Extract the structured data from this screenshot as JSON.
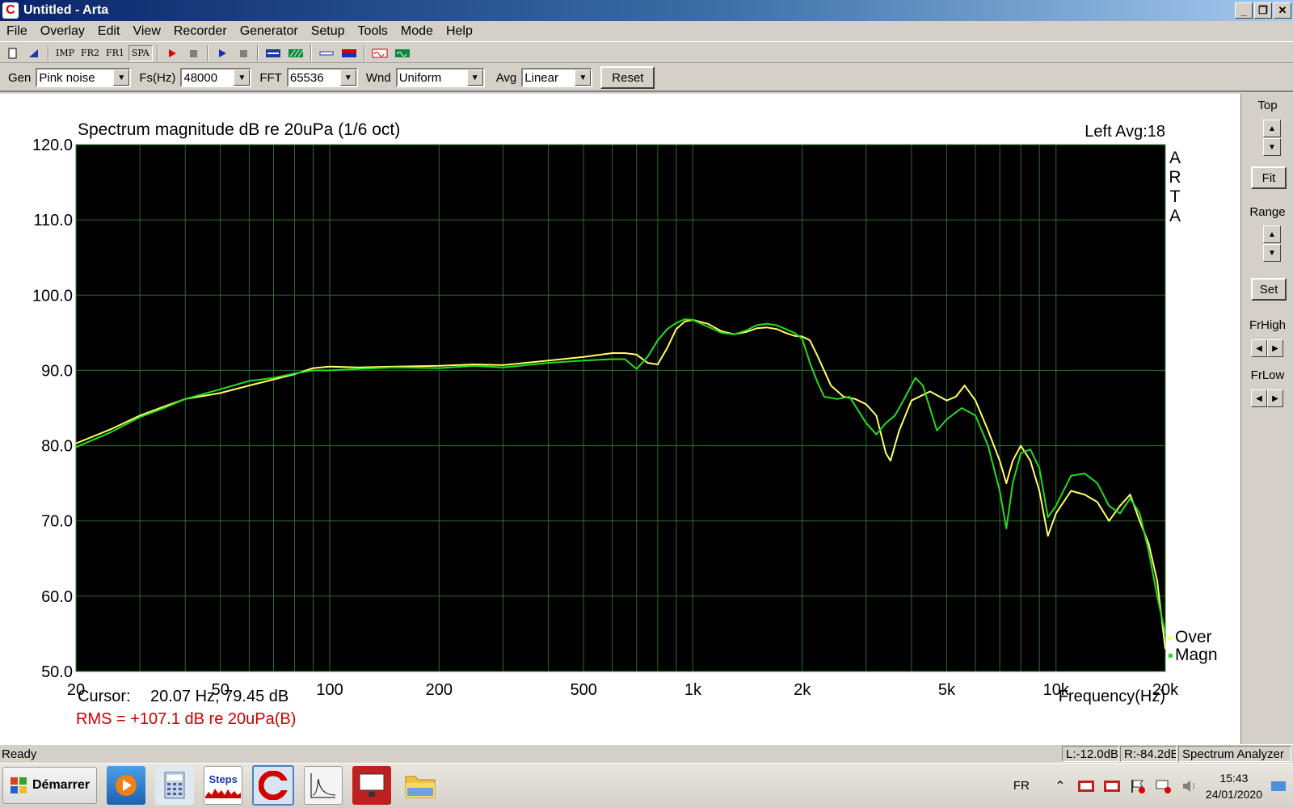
{
  "window": {
    "title": "Untitled - Arta"
  },
  "menu": [
    "File",
    "Overlay",
    "Edit",
    "View",
    "Recorder",
    "Generator",
    "Setup",
    "Tools",
    "Mode",
    "Help"
  ],
  "toolbar": {
    "imp": "IMP",
    "fr2": "FR2",
    "fr1": "FR1",
    "spa": "SPA"
  },
  "controls": {
    "gen_label": "Gen",
    "gen_value": "Pink noise",
    "fs_label": "Fs(Hz)",
    "fs_value": "48000",
    "fft_label": "FFT",
    "fft_value": "65536",
    "wnd_label": "Wnd",
    "wnd_value": "Uniform",
    "avg_label": "Avg",
    "avg_value": "Linear",
    "reset_label": "Reset"
  },
  "right_panel": {
    "top": "Top",
    "fit": "Fit",
    "range": "Range",
    "set": "Set",
    "frhigh": "FrHigh",
    "frlow": "FrLow"
  },
  "plot": {
    "cursor_label": "Cursor:",
    "cursor_value": "20.07 Hz, 79.45 dB",
    "rms": "RMS = +107.1 dB re 20uPa(B)",
    "brand": "ARTA"
  },
  "status": {
    "ready": "Ready",
    "left": "L:-12.0dB",
    "right": "R:-84.2dB",
    "mode": "Spectrum Analyzer"
  },
  "taskbar": {
    "start": "Démarrer",
    "steps": "Steps",
    "lang": "FR",
    "time": "15:43",
    "date": "24/01/2020"
  },
  "colors": {
    "over": "#ffff66",
    "magn": "#22dd22",
    "grid": "#2e6b2e",
    "rms": "#cc0000"
  },
  "chart_data": {
    "type": "line",
    "title": "Spectrum magnitude dB re 20uPa (1/6 oct)",
    "top_right_label": "Left  Avg:18",
    "xlabel": "Frequency(Hz)",
    "ylabel": "",
    "xscale": "log",
    "xlim": [
      20,
      20000
    ],
    "ylim": [
      50,
      120
    ],
    "xticks": [
      {
        "v": 20,
        "label": "20"
      },
      {
        "v": 50,
        "label": "50"
      },
      {
        "v": 100,
        "label": "100"
      },
      {
        "v": 200,
        "label": "200"
      },
      {
        "v": 500,
        "label": "500"
      },
      {
        "v": 1000,
        "label": "1k"
      },
      {
        "v": 2000,
        "label": "2k"
      },
      {
        "v": 5000,
        "label": "5k"
      },
      {
        "v": 10000,
        "label": "10k"
      },
      {
        "v": 20000,
        "label": "20k"
      }
    ],
    "yticks": [
      {
        "v": 120,
        "label": "120.0"
      },
      {
        "v": 110,
        "label": "110.0"
      },
      {
        "v": 100,
        "label": "100.0"
      },
      {
        "v": 90,
        "label": "90.0"
      },
      {
        "v": 80,
        "label": "80.0"
      },
      {
        "v": 70,
        "label": "70.0"
      },
      {
        "v": 60,
        "label": "60.0"
      },
      {
        "v": 50,
        "label": "50.0"
      }
    ],
    "grid": true,
    "legend_position": "bottom-right",
    "series": [
      {
        "name": "Over",
        "color": "#ffff66",
        "points": [
          [
            20,
            80.3
          ],
          [
            25,
            82.2
          ],
          [
            30,
            84
          ],
          [
            35,
            85.2
          ],
          [
            40,
            86.2
          ],
          [
            50,
            87
          ],
          [
            60,
            88
          ],
          [
            70,
            88.8
          ],
          [
            80,
            89.5
          ],
          [
            90,
            90.3
          ],
          [
            100,
            90.5
          ],
          [
            120,
            90.4
          ],
          [
            150,
            90.5
          ],
          [
            200,
            90.6
          ],
          [
            250,
            90.8
          ],
          [
            300,
            90.7
          ],
          [
            400,
            91.3
          ],
          [
            500,
            91.8
          ],
          [
            600,
            92.3
          ],
          [
            650,
            92.3
          ],
          [
            700,
            92.1
          ],
          [
            750,
            91
          ],
          [
            800,
            90.8
          ],
          [
            850,
            93
          ],
          [
            900,
            95.5
          ],
          [
            950,
            96.5
          ],
          [
            1000,
            96.7
          ],
          [
            1100,
            96.2
          ],
          [
            1200,
            95.2
          ],
          [
            1300,
            94.8
          ],
          [
            1400,
            95.1
          ],
          [
            1500,
            95.6
          ],
          [
            1600,
            95.7
          ],
          [
            1700,
            95.5
          ],
          [
            1800,
            95
          ],
          [
            1900,
            94.6
          ],
          [
            2000,
            94.5
          ],
          [
            2100,
            94
          ],
          [
            2200,
            92
          ],
          [
            2400,
            88
          ],
          [
            2600,
            86.5
          ],
          [
            2800,
            86.2
          ],
          [
            3000,
            85.5
          ],
          [
            3200,
            84
          ],
          [
            3400,
            79
          ],
          [
            3500,
            78
          ],
          [
            3700,
            82
          ],
          [
            4000,
            86
          ],
          [
            4500,
            87.2
          ],
          [
            5000,
            86
          ],
          [
            5300,
            86.5
          ],
          [
            5600,
            88
          ],
          [
            6000,
            86
          ],
          [
            6500,
            82
          ],
          [
            7000,
            78
          ],
          [
            7300,
            75
          ],
          [
            7600,
            78
          ],
          [
            8000,
            80
          ],
          [
            8500,
            78
          ],
          [
            9000,
            74
          ],
          [
            9500,
            68
          ],
          [
            10000,
            71
          ],
          [
            11000,
            74
          ],
          [
            12000,
            73.5
          ],
          [
            13000,
            72.5
          ],
          [
            14000,
            70
          ],
          [
            15000,
            72
          ],
          [
            16000,
            73.5
          ],
          [
            17000,
            70
          ],
          [
            18000,
            67
          ],
          [
            19000,
            62
          ],
          [
            20000,
            53
          ]
        ]
      },
      {
        "name": "Magn",
        "color": "#22dd22",
        "points": [
          [
            20,
            79.8
          ],
          [
            25,
            81.8
          ],
          [
            30,
            83.8
          ],
          [
            35,
            85
          ],
          [
            40,
            86.2
          ],
          [
            50,
            87.5
          ],
          [
            60,
            88.6
          ],
          [
            70,
            89
          ],
          [
            80,
            89.6
          ],
          [
            90,
            90
          ],
          [
            100,
            90
          ],
          [
            120,
            90.2
          ],
          [
            150,
            90.4
          ],
          [
            200,
            90.3
          ],
          [
            250,
            90.6
          ],
          [
            300,
            90.4
          ],
          [
            400,
            91
          ],
          [
            500,
            91.3
          ],
          [
            600,
            91.5
          ],
          [
            650,
            91.5
          ],
          [
            700,
            90.2
          ],
          [
            750,
            91.8
          ],
          [
            800,
            94
          ],
          [
            850,
            95.5
          ],
          [
            900,
            96.3
          ],
          [
            950,
            96.8
          ],
          [
            1000,
            96.7
          ],
          [
            1100,
            95.8
          ],
          [
            1200,
            95
          ],
          [
            1300,
            94.8
          ],
          [
            1400,
            95.3
          ],
          [
            1500,
            96
          ],
          [
            1600,
            96.2
          ],
          [
            1700,
            96
          ],
          [
            1800,
            95.5
          ],
          [
            1900,
            95
          ],
          [
            2000,
            94.2
          ],
          [
            2100,
            91
          ],
          [
            2200,
            88.5
          ],
          [
            2300,
            86.5
          ],
          [
            2500,
            86.2
          ],
          [
            2700,
            86.5
          ],
          [
            3000,
            83
          ],
          [
            3200,
            81.5
          ],
          [
            3400,
            83
          ],
          [
            3600,
            84
          ],
          [
            3800,
            86
          ],
          [
            4100,
            89
          ],
          [
            4300,
            88
          ],
          [
            4700,
            82
          ],
          [
            5000,
            83.5
          ],
          [
            5500,
            85
          ],
          [
            6000,
            84
          ],
          [
            6500,
            80
          ],
          [
            7000,
            74
          ],
          [
            7300,
            69
          ],
          [
            7600,
            75
          ],
          [
            8000,
            79
          ],
          [
            8500,
            79.5
          ],
          [
            9000,
            77
          ],
          [
            9500,
            70.5
          ],
          [
            10000,
            72
          ],
          [
            11000,
            76
          ],
          [
            12000,
            76.3
          ],
          [
            13000,
            75
          ],
          [
            14000,
            72
          ],
          [
            15000,
            71
          ],
          [
            16000,
            73
          ],
          [
            17000,
            71
          ],
          [
            18000,
            66
          ],
          [
            19000,
            60
          ],
          [
            20000,
            55
          ]
        ]
      }
    ]
  }
}
